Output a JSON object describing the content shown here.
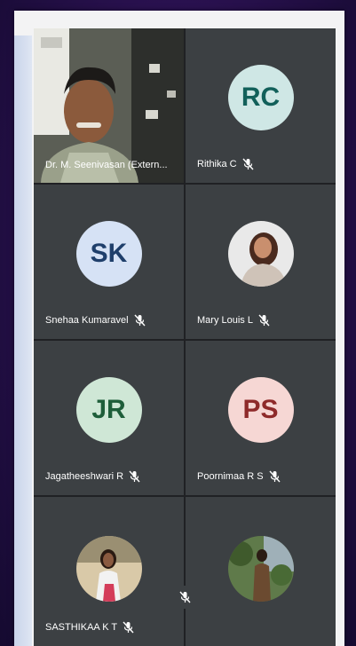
{
  "participants": [
    {
      "name": "Dr. M. Seenivasan (Extern...",
      "type": "video"
    },
    {
      "name": "Rithika C",
      "initials": "RC",
      "avatar_bg": "#cfe7e5",
      "avatar_fg": "#12605a",
      "muted": true
    },
    {
      "name": "Snehaa Kumaravel",
      "initials": "SK",
      "avatar_bg": "#d6e2f5",
      "avatar_fg": "#1f3f6b",
      "muted": true
    },
    {
      "name": "Mary Louis L",
      "type": "photo",
      "muted": true
    },
    {
      "name": "Jagatheeshwari R",
      "initials": "JR",
      "avatar_bg": "#cfe7d6",
      "avatar_fg": "#1e5e3a",
      "muted": true
    },
    {
      "name": "Poornimaa  R S",
      "initials": "PS",
      "avatar_bg": "#f6d7d4",
      "avatar_fg": "#8e2a2a",
      "muted": true
    },
    {
      "name": "SASTHIKAA K T",
      "type": "photo",
      "muted": true
    },
    {
      "name": "",
      "type": "photo"
    }
  ],
  "icons": {
    "mute": "mic-off-icon"
  }
}
